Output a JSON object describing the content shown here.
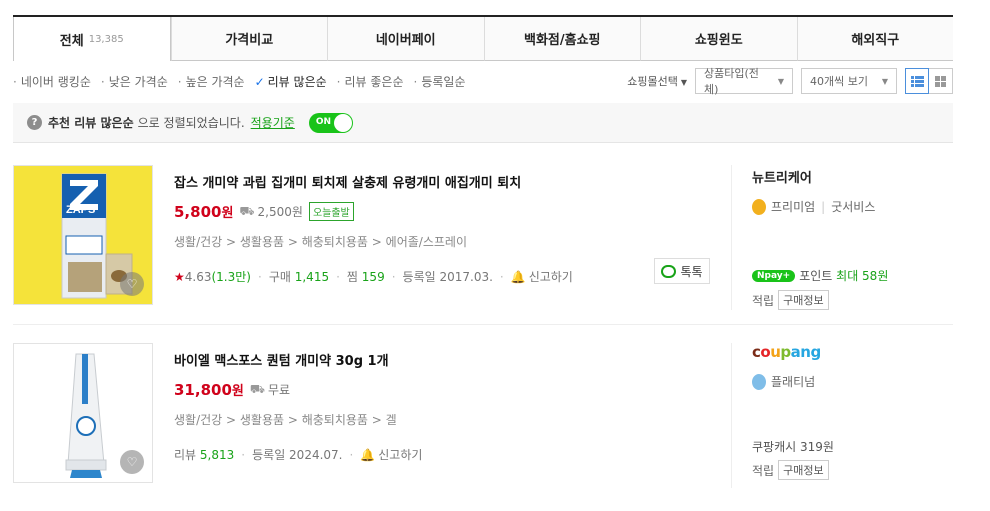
{
  "tabs": [
    {
      "label": "전체",
      "count": "13,385"
    },
    {
      "label": "가격비교"
    },
    {
      "label": "네이버페이"
    },
    {
      "label": "백화점/홈쇼핑"
    },
    {
      "label": "쇼핑윈도"
    },
    {
      "label": "해외직구"
    }
  ],
  "sort": [
    {
      "label": "네이버 랭킹순"
    },
    {
      "label": "낮은 가격순"
    },
    {
      "label": "높은 가격순"
    },
    {
      "label": "리뷰 많은순"
    },
    {
      "label": "리뷰 좋은순"
    },
    {
      "label": "등록일순"
    }
  ],
  "controls": {
    "mall_select": "쇼핑몰선택",
    "product_type": "상품타입(전체)",
    "per_page": "40개씩 보기"
  },
  "notice": {
    "bold": "추천 리뷰 많은순",
    "text": "으로 정렬되었습니다.",
    "link": "적용기준",
    "toggle": "ON"
  },
  "items": [
    {
      "title": "잡스 개미약 과립 집개미 퇴치제 살충제 유령개미 애집개미 퇴치",
      "price": "5,800",
      "won": "원",
      "shipping": "2,500원",
      "badge": "오늘출발",
      "category": "생활/건강 > 생활용품 > 해충퇴치용품 > 에어졸/스프레이",
      "rating": "4.63",
      "rating_count": "(1.3만)",
      "purchase_label": "구매",
      "purchase_count": "1,415",
      "zzim_label": "찜",
      "zzim_count": "159",
      "reg_date": "등록일 2017.03.",
      "report": "신고하기",
      "talk": "톡톡",
      "seller": "뉴트리케어",
      "grade": "프리미엄",
      "service": "굿서비스",
      "npay_logo": "pay",
      "point_label": "포인트",
      "point_value": "최대 58원",
      "buy_label": "적립",
      "buy_box": "구매정보",
      "thumb_brand": "ZAPS"
    },
    {
      "title": "바이엘 맥스포스 퀀텀 개미약 30g 1개",
      "price": "31,800",
      "won": "원",
      "shipping": "무료",
      "category": "생활/건강 > 생활용품 > 해충퇴치용품 > 겔",
      "review_label": "리뷰",
      "review_count": "5,813",
      "reg_date": "등록일 2024.07.",
      "report": "신고하기",
      "seller_parts": [
        "c",
        "o",
        "u",
        "p",
        "a",
        "n",
        "g"
      ],
      "seller": "coupang",
      "grade": "플래티넘",
      "cash": "쿠팡캐시 319원",
      "buy_label": "적립",
      "buy_box": "구매정보"
    }
  ]
}
